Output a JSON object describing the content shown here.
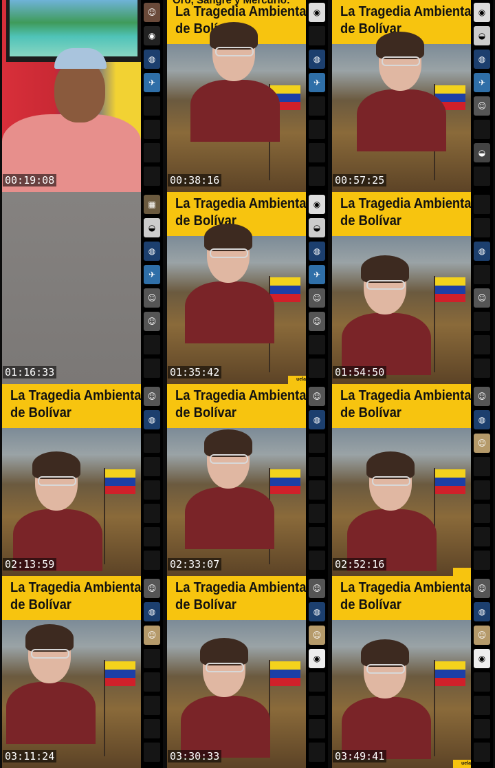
{
  "poster": {
    "top_line": "Oro, Sangre y Mercurio:",
    "title_line1": "La Tragedia Ambiental",
    "title_line2": "de Bolívar",
    "corner_tag": "uela"
  },
  "thumbnails": [
    {
      "time": "00:19:08"
    },
    {
      "time": "00:38:16"
    },
    {
      "time": "00:57:25"
    },
    {
      "time": "01:16:33"
    },
    {
      "time": "01:35:42"
    },
    {
      "time": "01:54:50"
    },
    {
      "time": "02:13:59"
    },
    {
      "time": "02:33:07"
    },
    {
      "time": "02:52:16"
    },
    {
      "time": "03:11:24"
    },
    {
      "time": "03:30:33"
    },
    {
      "time": "03:49:41"
    }
  ],
  "colors": {
    "banner": "#f7c40f",
    "sweater": "#7a2428",
    "filmstrip": "#000000"
  },
  "icons": [
    "avatar-icon",
    "globe-icon",
    "bird-icon",
    "eye-icon",
    "helmet-icon"
  ]
}
